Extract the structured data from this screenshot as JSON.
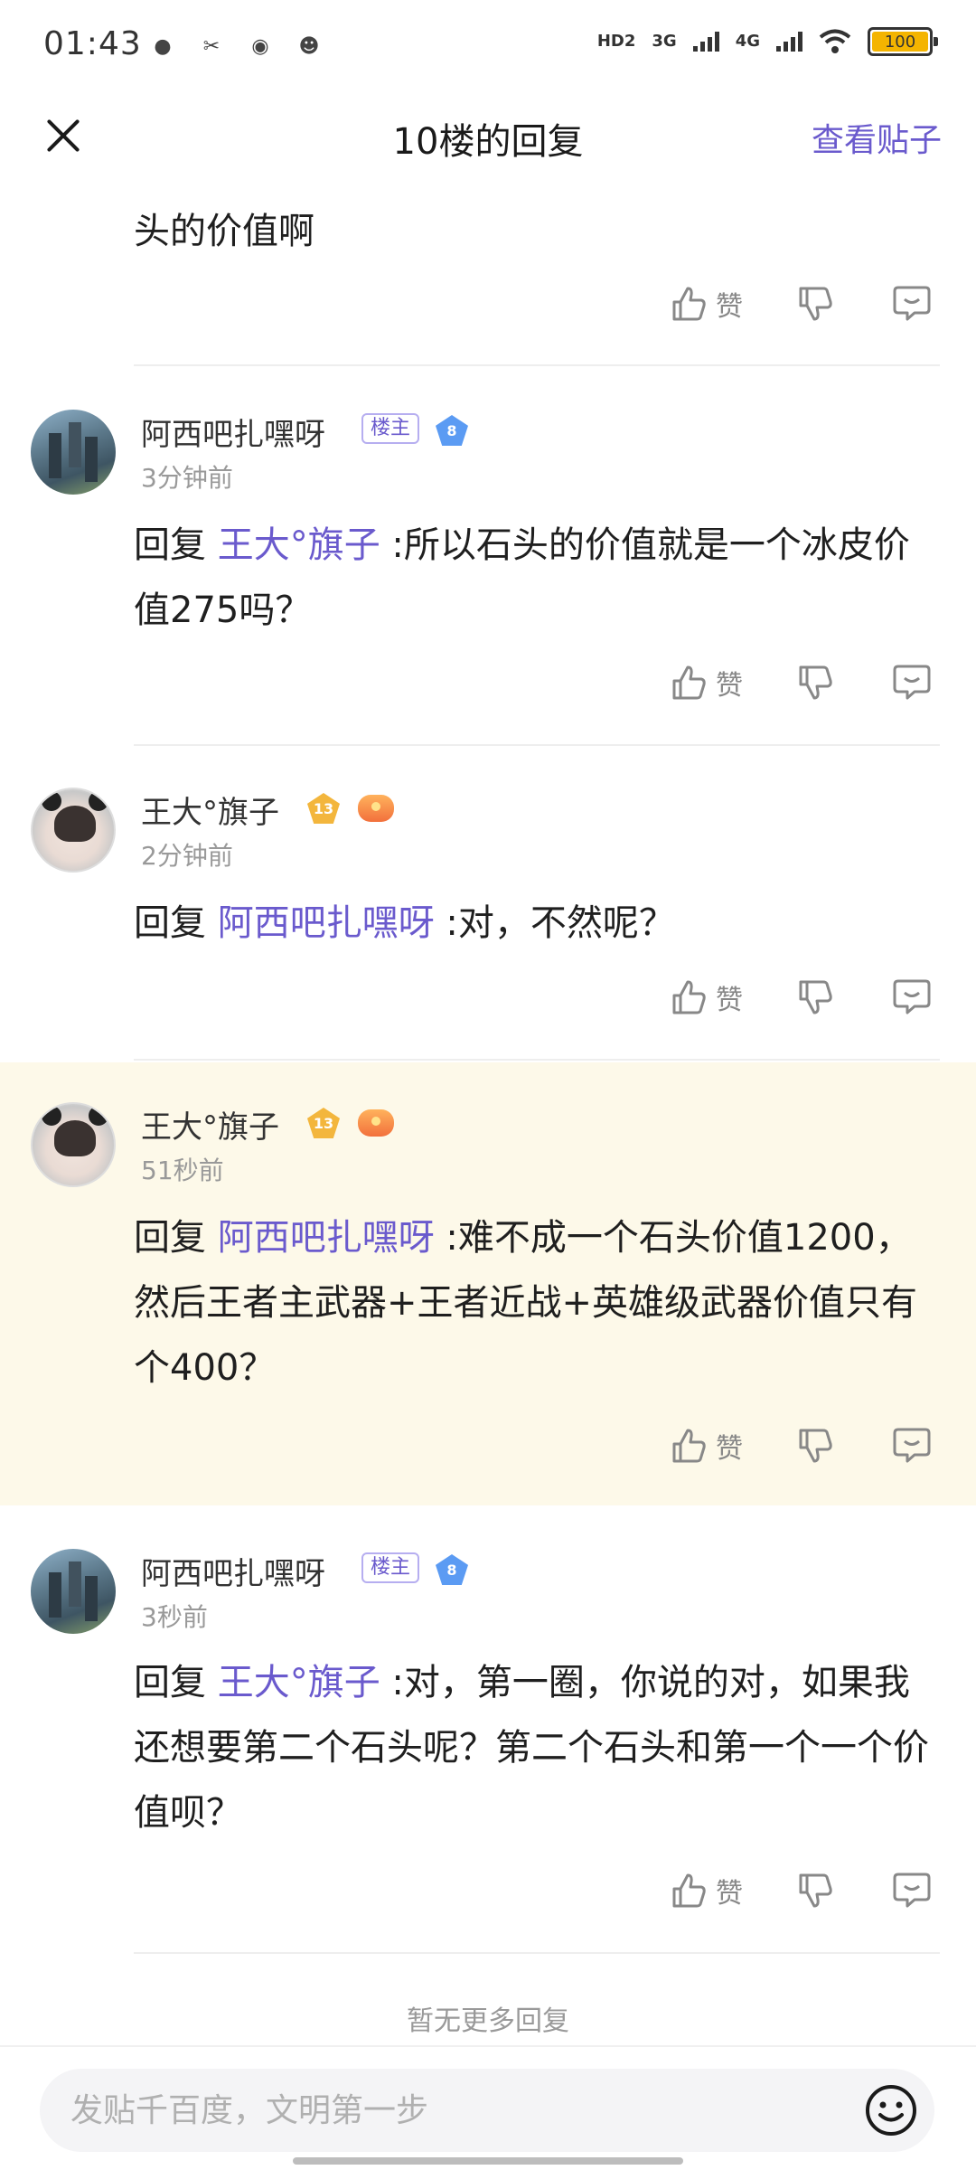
{
  "status_bar": {
    "time": "01:43",
    "network_1": "HD2",
    "network_2": "3G",
    "network_3": "4G",
    "battery": "100"
  },
  "header": {
    "title": "10楼的回复",
    "view_post": "查看贴子"
  },
  "partial_comment": {
    "text": "头的价值啊"
  },
  "actions": {
    "like_label": "赞"
  },
  "comments": [
    {
      "user": "阿西吧扎嘿呀",
      "owner_badge": "楼主",
      "level": "8",
      "time": "3分钟前",
      "reply_prefix": "回复 ",
      "mention": "王大°旗子",
      "text": " :所以石头的价值就是一个冰皮价值275吗？"
    },
    {
      "user": "王大°旗子",
      "level": "13",
      "time": "2分钟前",
      "reply_prefix": "回复 ",
      "mention": "阿西吧扎嘿呀",
      "text": " :对，不然呢？"
    },
    {
      "user": "王大°旗子",
      "level": "13",
      "time": "51秒前",
      "reply_prefix": "回复 ",
      "mention": "阿西吧扎嘿呀",
      "text": " :难不成一个石头价值1200，然后王者主武器+王者近战+英雄级武器价值只有个400？"
    },
    {
      "user": "阿西吧扎嘿呀",
      "owner_badge": "楼主",
      "level": "8",
      "time": "3秒前",
      "reply_prefix": "回复 ",
      "mention": "王大°旗子",
      "text": " :对，第一圈，你说的对，如果我还想要第二个石头呢？第二个石头和第一个一个价值呗？"
    }
  ],
  "footer": {
    "no_more": "暂无更多回复",
    "input_placeholder": "发贴千百度，文明第一步"
  },
  "colors": {
    "accent": "#6a5acd",
    "highlight_bg": "#fdf9e9",
    "muted": "#999999"
  },
  "icons": [
    "close-icon",
    "thumbs-up-icon",
    "thumbs-down-icon",
    "reply-bubble-icon",
    "emoji-icon"
  ]
}
